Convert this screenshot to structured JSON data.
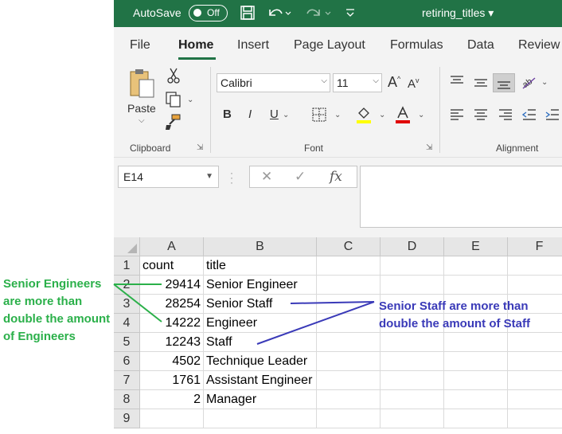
{
  "titlebar": {
    "autosave_label": "AutoSave",
    "autosave_state": "Off",
    "filename": "retiring_titles"
  },
  "tabs": [
    "File",
    "Home",
    "Insert",
    "Page Layout",
    "Formulas",
    "Data",
    "Review"
  ],
  "active_tab": "Home",
  "ribbon": {
    "clipboard": {
      "paste_label": "Paste",
      "group_label": "Clipboard"
    },
    "font": {
      "font_name": "Calibri",
      "font_size": "11",
      "group_label": "Font",
      "bold": "B",
      "italic": "I",
      "underline": "U",
      "grow": "A",
      "shrink": "A"
    },
    "alignment": {
      "group_label": "Alignment"
    }
  },
  "formula_bar": {
    "name_box": "E14",
    "fx": "fx",
    "content": ""
  },
  "grid": {
    "columns": [
      "A",
      "B",
      "C",
      "D",
      "E",
      "F"
    ],
    "rows": [
      "1",
      "2",
      "3",
      "4",
      "5",
      "6",
      "7",
      "8",
      "9"
    ],
    "data": [
      [
        "count",
        "title"
      ],
      [
        "29414",
        "Senior Engineer"
      ],
      [
        "28254",
        "Senior Staff"
      ],
      [
        "14222",
        "Engineer"
      ],
      [
        "12243",
        "Staff"
      ],
      [
        "4502",
        "Technique Leader"
      ],
      [
        "1761",
        "Assistant Engineer"
      ],
      [
        "2",
        "Manager"
      ],
      [
        "",
        ""
      ]
    ]
  },
  "annotations": {
    "green": "Senior Engineers are more than double the amount of Engineers",
    "blue": "Senior Staff are more than double the amount of Staff",
    "green_color": "#2bb04a",
    "blue_color": "#3a3ab8"
  },
  "colors": {
    "excel_green": "#217346",
    "ribbon_bg": "#f3f3f3"
  }
}
